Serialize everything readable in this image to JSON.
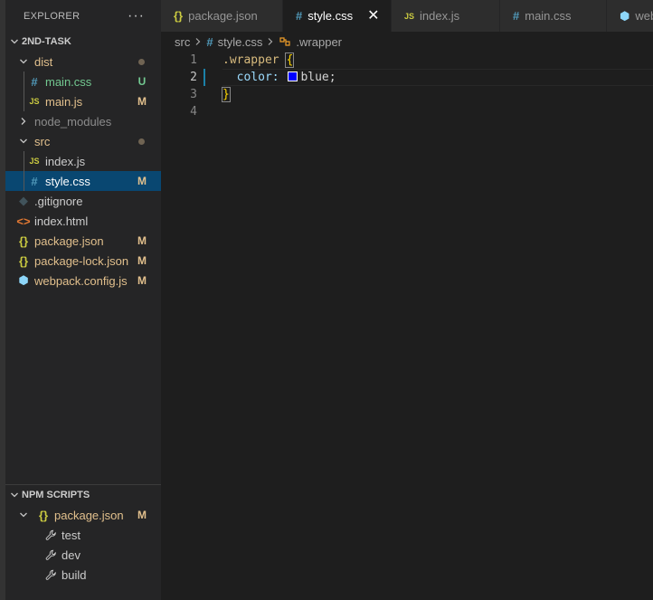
{
  "explorer": {
    "title": "EXPLORER",
    "more": "···",
    "project": "2ND-TASK",
    "tree": [
      {
        "label": "dist",
        "depth": 1,
        "kind": "folder-open",
        "status": "dot",
        "color": "#e2c08d"
      },
      {
        "label": "main.css",
        "depth": 2,
        "icon": "css",
        "status": "U",
        "color": "#73c991"
      },
      {
        "label": "main.js",
        "depth": 2,
        "icon": "js",
        "status": "M",
        "color": "#e2c08d"
      },
      {
        "label": "node_modules",
        "depth": 1,
        "kind": "folder-closed",
        "status": "",
        "color": "#8c8c8c"
      },
      {
        "label": "src",
        "depth": 1,
        "kind": "folder-open",
        "status": "dot",
        "color": "#e2c08d"
      },
      {
        "label": "index.js",
        "depth": 2,
        "icon": "js",
        "status": "",
        "color": "#cccccc"
      },
      {
        "label": "style.css",
        "depth": 2,
        "icon": "css",
        "status": "M",
        "color": "#e2c08d",
        "selected": true
      },
      {
        "label": ".gitignore",
        "depth": 1,
        "icon": "git",
        "status": "",
        "color": "#cccccc"
      },
      {
        "label": "index.html",
        "depth": 1,
        "icon": "html",
        "status": "",
        "color": "#cccccc"
      },
      {
        "label": "package.json",
        "depth": 1,
        "icon": "json",
        "status": "M",
        "color": "#e2c08d"
      },
      {
        "label": "package-lock.json",
        "depth": 1,
        "icon": "json",
        "status": "M",
        "color": "#e2c08d"
      },
      {
        "label": "webpack.config.js",
        "depth": 1,
        "icon": "webpack",
        "status": "M",
        "color": "#e2c08d"
      }
    ]
  },
  "npm_scripts": {
    "title": "NPM SCRIPTS",
    "package": {
      "label": "package.json",
      "status": "M"
    },
    "scripts": [
      "test",
      "dev",
      "build"
    ]
  },
  "tabs": [
    {
      "label": "package.json",
      "icon": "json",
      "icon_glyph": "{}",
      "active": false
    },
    {
      "label": "style.css",
      "icon": "css",
      "icon_glyph": "#",
      "active": true,
      "close": "✕"
    },
    {
      "label": "index.js",
      "icon": "js",
      "icon_glyph": "JS",
      "active": false
    },
    {
      "label": "main.css",
      "icon": "css",
      "icon_glyph": "#",
      "active": false
    },
    {
      "label": "webpack.config.js",
      "icon": "webpack",
      "icon_glyph": "⬢",
      "active": false
    }
  ],
  "breadcrumb": {
    "folder": "src",
    "file": "style.css",
    "symbol": ".wrapper"
  },
  "editor": {
    "line_numbers": [
      "1",
      "2",
      "3",
      "4"
    ],
    "active_line": 2,
    "code": {
      "selector": ".wrapper",
      "open_brace": "{",
      "property": "color:",
      "value": "blue;",
      "swatch_color": "#0000ff",
      "close_brace": "}"
    }
  },
  "icon_glyphs": {
    "css": "#",
    "js": "JS",
    "json": "{}",
    "html": "<>",
    "git": "◆",
    "webpack": "⬢"
  }
}
